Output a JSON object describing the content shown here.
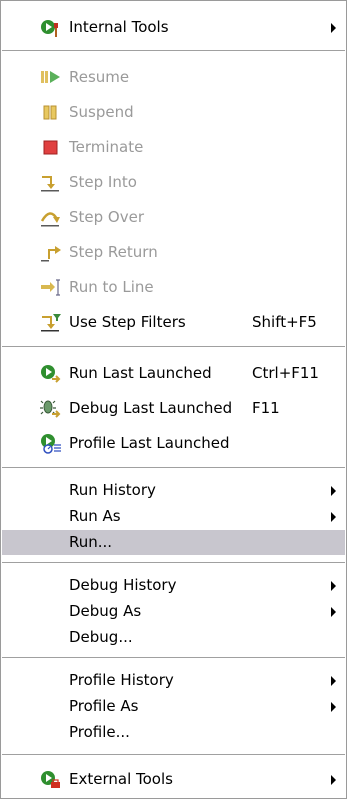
{
  "menu": {
    "internal_tools": "Internal Tools",
    "resume": "Resume",
    "suspend": "Suspend",
    "terminate": "Terminate",
    "step_into": "Step Into",
    "step_over": "Step Over",
    "step_return": "Step Return",
    "run_to_line": "Run to Line",
    "use_step_filters": "Use Step Filters",
    "use_step_filters_shortcut": "Shift+F5",
    "run_last_launched": "Run Last Launched",
    "run_last_launched_shortcut": "Ctrl+F11",
    "debug_last_launched": "Debug Last Launched",
    "debug_last_launched_shortcut": "F11",
    "profile_last_launched": "Profile Last Launched",
    "run_history": "Run History",
    "run_as": "Run As",
    "run": "Run...",
    "debug_history": "Debug History",
    "debug_as": "Debug As",
    "debug": "Debug...",
    "profile_history": "Profile History",
    "profile_as": "Profile As",
    "profile": "Profile...",
    "external_tools": "External Tools"
  },
  "colors": {
    "selected_bg": "#c8c6ce",
    "disabled_text": "#9a9a9a",
    "green": "#2f8f2f",
    "red": "#d03020"
  }
}
